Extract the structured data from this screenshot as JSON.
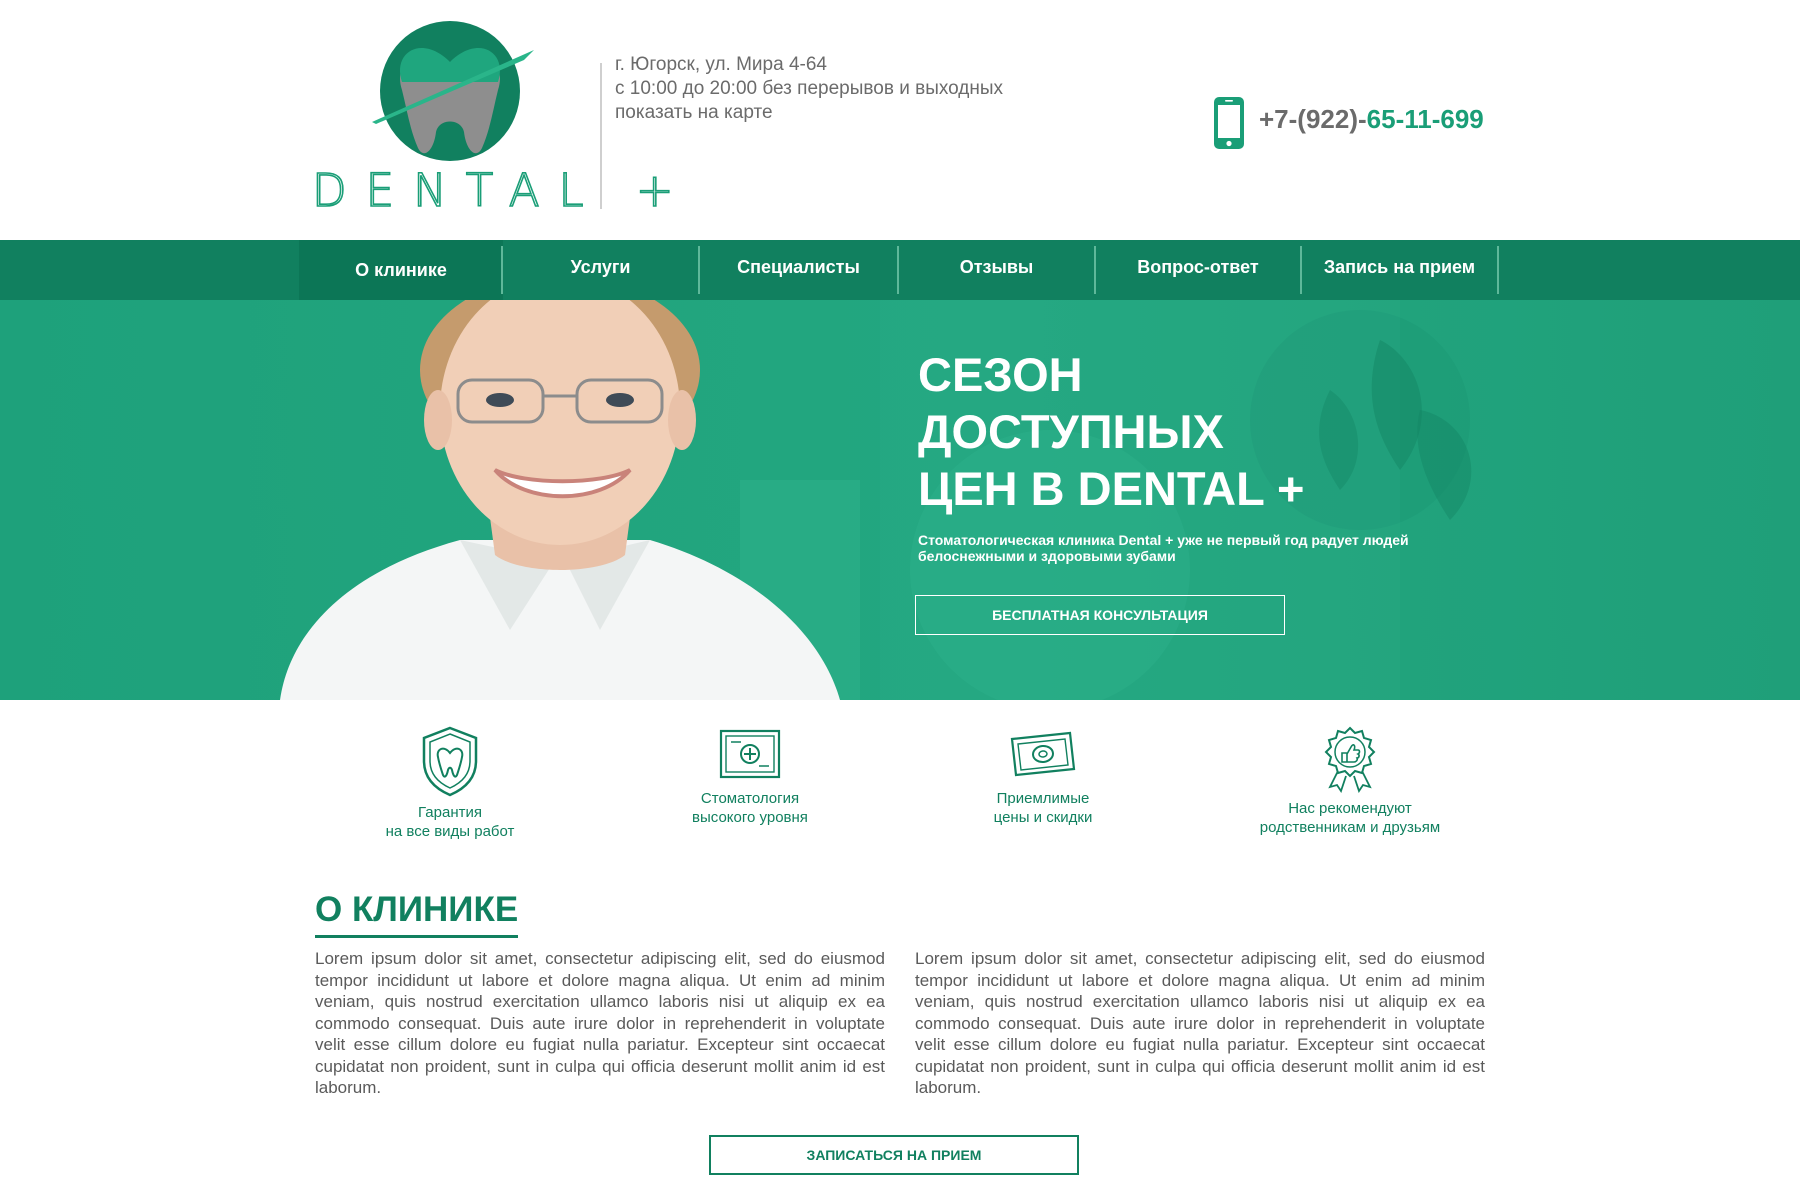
{
  "header": {
    "logo_text": "DENTAL +",
    "address_line": "г. Югорск, ул. Мира 4-64",
    "hours_line": "с 10:00 до 20:00 без перерывов и выходных",
    "map_link": "показать на карте",
    "phone_prefix": "+7-(922)-",
    "phone_number": "65-11-699",
    "phone_icon": "phone-icon"
  },
  "nav": {
    "items": [
      {
        "label": "О клинике"
      },
      {
        "label": "Услуги"
      },
      {
        "label": "Специалисты"
      },
      {
        "label": "Отзывы"
      },
      {
        "label": "Вопрос-ответ"
      },
      {
        "label": "Запись на прием"
      }
    ]
  },
  "hero": {
    "title_line1": "СЕЗОН",
    "title_line2": "ДОСТУПНЫХ",
    "title_line3": "ЦЕН В DENTAL +",
    "subtitle": "Стоматологическая клиника Dental + уже не первый год радует людей белоснежными и здоровыми зубами",
    "button_label": "БЕСПЛАТНАЯ КОНСУЛЬТАЦИЯ"
  },
  "features": [
    {
      "icon": "shield-tooth-icon",
      "line1": "Гарантия",
      "line2": "на все виды работ"
    },
    {
      "icon": "certificate-icon",
      "line1": "Стоматология",
      "line2": "высокого уровня"
    },
    {
      "icon": "banknote-icon",
      "line1": "Приемлимые",
      "line2": "цены и скидки"
    },
    {
      "icon": "thumbs-up-badge-icon",
      "line1": "Нас рекомендуют",
      "line2": "родственникам и друзьям"
    }
  ],
  "about": {
    "title": "О КЛИНИКЕ",
    "paragraph1": "Lorem ipsum dolor sit amet, consectetur adipiscing elit, sed do eiusmod tempor incididunt ut labore et dolore magna aliqua. Ut enim ad minim veniam, quis nostrud exercitation ullamco laboris nisi ut aliquip ex ea commodo consequat. Duis aute irure dolor in reprehenderit in voluptate velit esse cillum dolore eu fugiat nulla pariatur. Excepteur sint occaecat cupidatat non proident, sunt in culpa qui officia deserunt mollit anim id est laborum.",
    "paragraph2": "Lorem ipsum dolor sit amet, consectetur adipiscing elit, sed do eiusmod tempor incididunt ut labore et dolore magna aliqua. Ut enim ad minim veniam, quis nostrud exercitation ullamco laboris nisi ut aliquip ex ea commodo consequat. Duis aute irure dolor in reprehenderit in voluptate velit esse cillum dolore eu fugiat nulla pariatur. Excepteur sint occaecat cupidatat non proident, sunt in culpa qui officia deserunt mollit anim id est laborum.",
    "button_label": "ЗАПИСАТЬСЯ НА ПРИЕМ"
  },
  "colors": {
    "brand_green": "#11805f",
    "hero_green": "#23a780",
    "text_gray": "#5d5d5d"
  }
}
